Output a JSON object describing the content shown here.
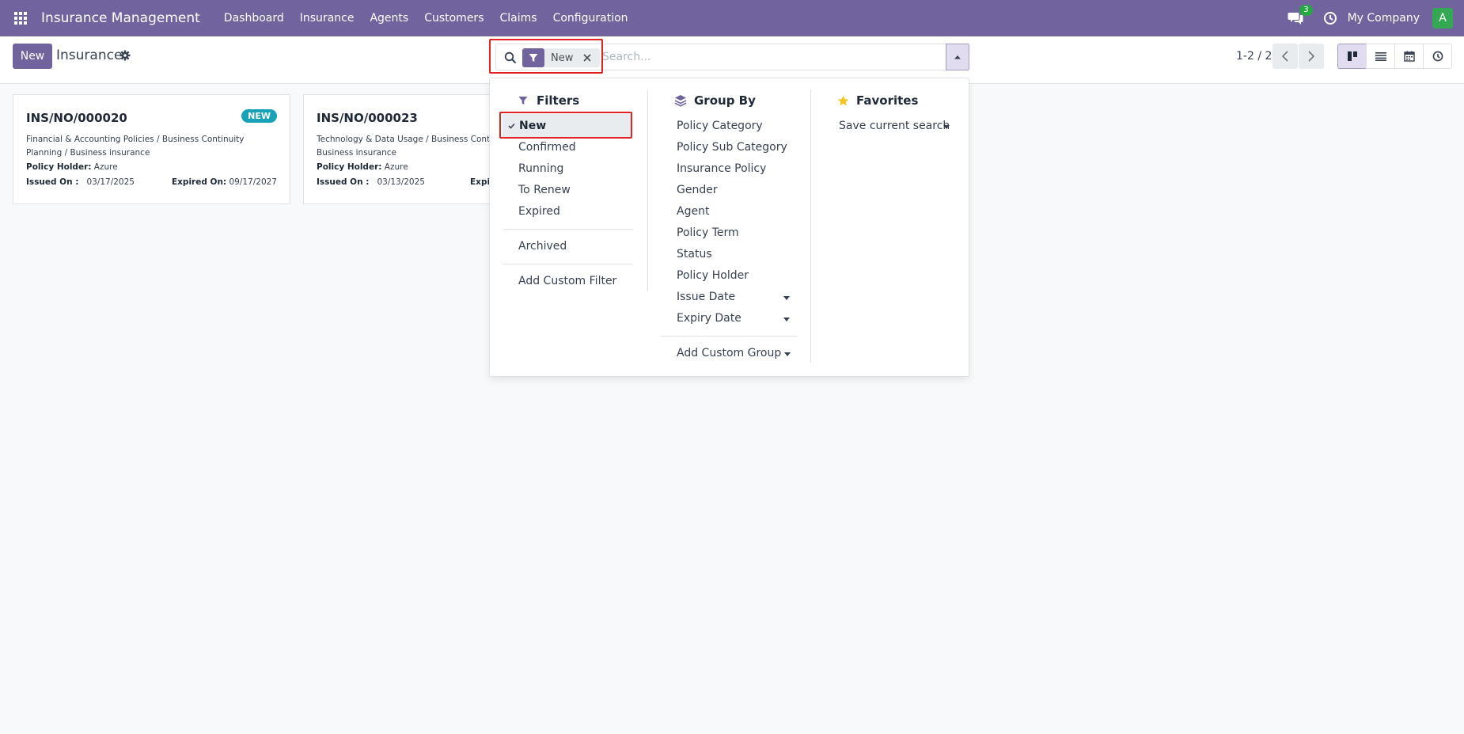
{
  "navbar": {
    "app_title": "Insurance Management",
    "menu": [
      "Dashboard",
      "Insurance",
      "Agents",
      "Customers",
      "Claims",
      "Configuration"
    ],
    "chat_count": "3",
    "company": "My Company",
    "avatar_letter": "A",
    "bg_color": "#71639e"
  },
  "control_panel": {
    "new_button": "New",
    "title": "Insurance",
    "search": {
      "facet_label": "New",
      "placeholder": "Search..."
    },
    "pager": "1-2 / 2"
  },
  "cards": [
    {
      "ref": "INS/NO/000020",
      "badge": "NEW",
      "description": "Financial & Accounting Policies / Business Continuity Planning / Business insurance",
      "holder_label": "Policy Holder:",
      "holder": "Azure",
      "issued_label": "Issued On :",
      "issued": "03/17/2025",
      "expired_label": "Expired On:",
      "expired": "09/17/2027"
    },
    {
      "ref": "INS/NO/000023",
      "description": "Technology & Data Usage / Business Continuity Planning / Business insurance",
      "holder_label": "Policy Holder:",
      "holder": "Azure",
      "issued_label": "Issued On :",
      "issued": "03/13/2025",
      "expired_label": "Expi"
    }
  ],
  "dropdown": {
    "filters": {
      "heading": "Filters",
      "selected": "New",
      "items": [
        "Confirmed",
        "Running",
        "To Renew",
        "Expired"
      ],
      "archived": "Archived",
      "add_custom": "Add Custom Filter"
    },
    "group_by": {
      "heading": "Group By",
      "items": [
        "Policy Category",
        "Policy Sub Category",
        "Insurance Policy",
        "Gender",
        "Agent",
        "Policy Term",
        "Status",
        "Policy Holder",
        "Issue Date",
        "Expiry Date"
      ],
      "add_custom": "Add Custom Group"
    },
    "favorites": {
      "heading": "Favorites",
      "save_current": "Save current search"
    }
  }
}
